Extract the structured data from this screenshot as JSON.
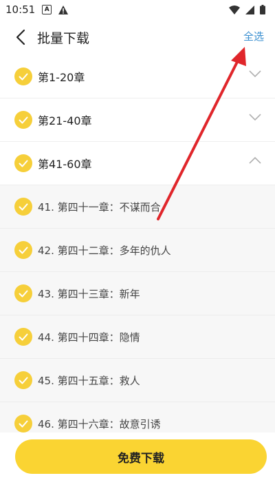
{
  "status_bar": {
    "time": "10:51",
    "a_icon_label": "A"
  },
  "header": {
    "title": "批量下载",
    "select_all_label": "全选"
  },
  "groups": [
    {
      "label": "第1-20章",
      "expanded": false
    },
    {
      "label": "第21-40章",
      "expanded": false
    },
    {
      "label": "第41-60章",
      "expanded": true
    }
  ],
  "chapters": [
    "41. 第四十一章：不谋而合",
    "42. 第四十二章：多年的仇人",
    "43. 第四十三章：新年",
    "44. 第四十四章：隐情",
    "45. 第四十五章：救人",
    "46. 第四十六章：故意引诱"
  ],
  "footer": {
    "download_label": "免费下载"
  },
  "colors": {
    "accent": "#fad432",
    "check": "#f6cf3a",
    "link": "#3a8fd0",
    "annotation_arrow": "#e0262b"
  }
}
